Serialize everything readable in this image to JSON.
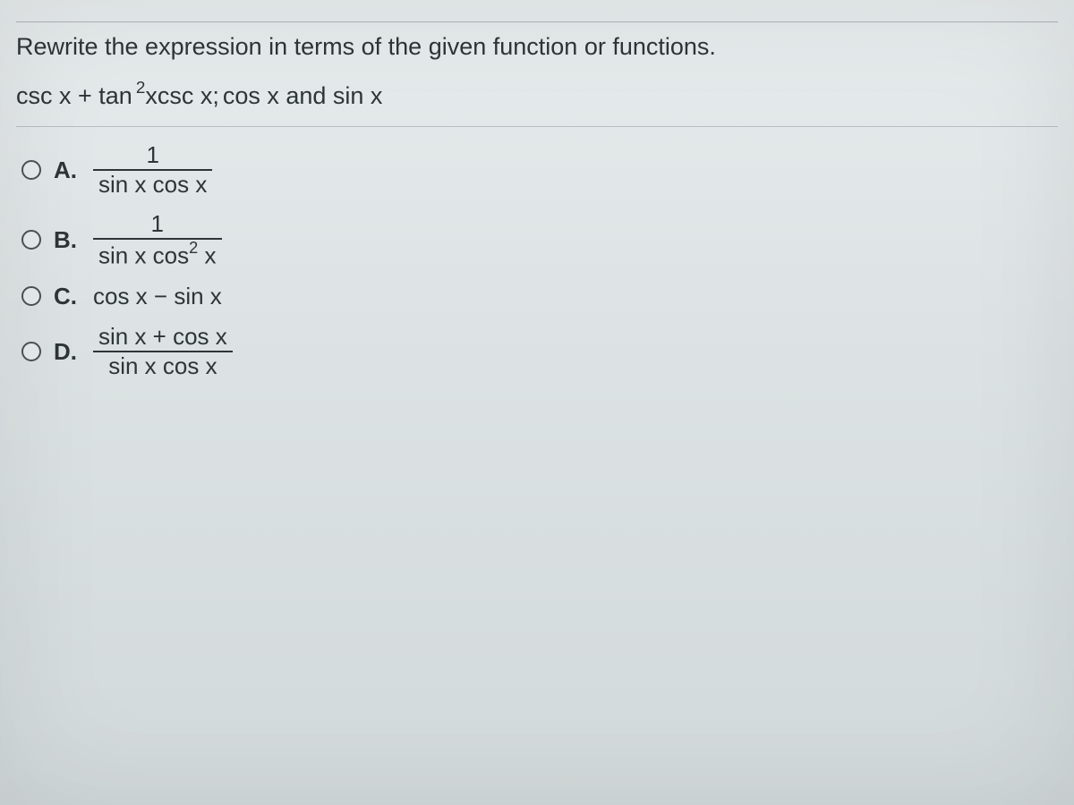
{
  "prompt": "Rewrite the expression in terms of the given function or functions.",
  "expression": {
    "part1": "csc x + tan",
    "sup1": "2",
    "part2": "xcsc x;",
    "given": "  cos x and sin x"
  },
  "options": {
    "a": {
      "letter": "A.",
      "num": "1",
      "den": "sin x cos x"
    },
    "b": {
      "letter": "B.",
      "num": "1",
      "den_left": "sin x cos",
      "den_sup": "2",
      "den_right": " x"
    },
    "c": {
      "letter": "C.",
      "text": "cos x − sin x"
    },
    "d": {
      "letter": "D.",
      "num": "sin x + cos x",
      "den": "sin x cos x"
    }
  }
}
